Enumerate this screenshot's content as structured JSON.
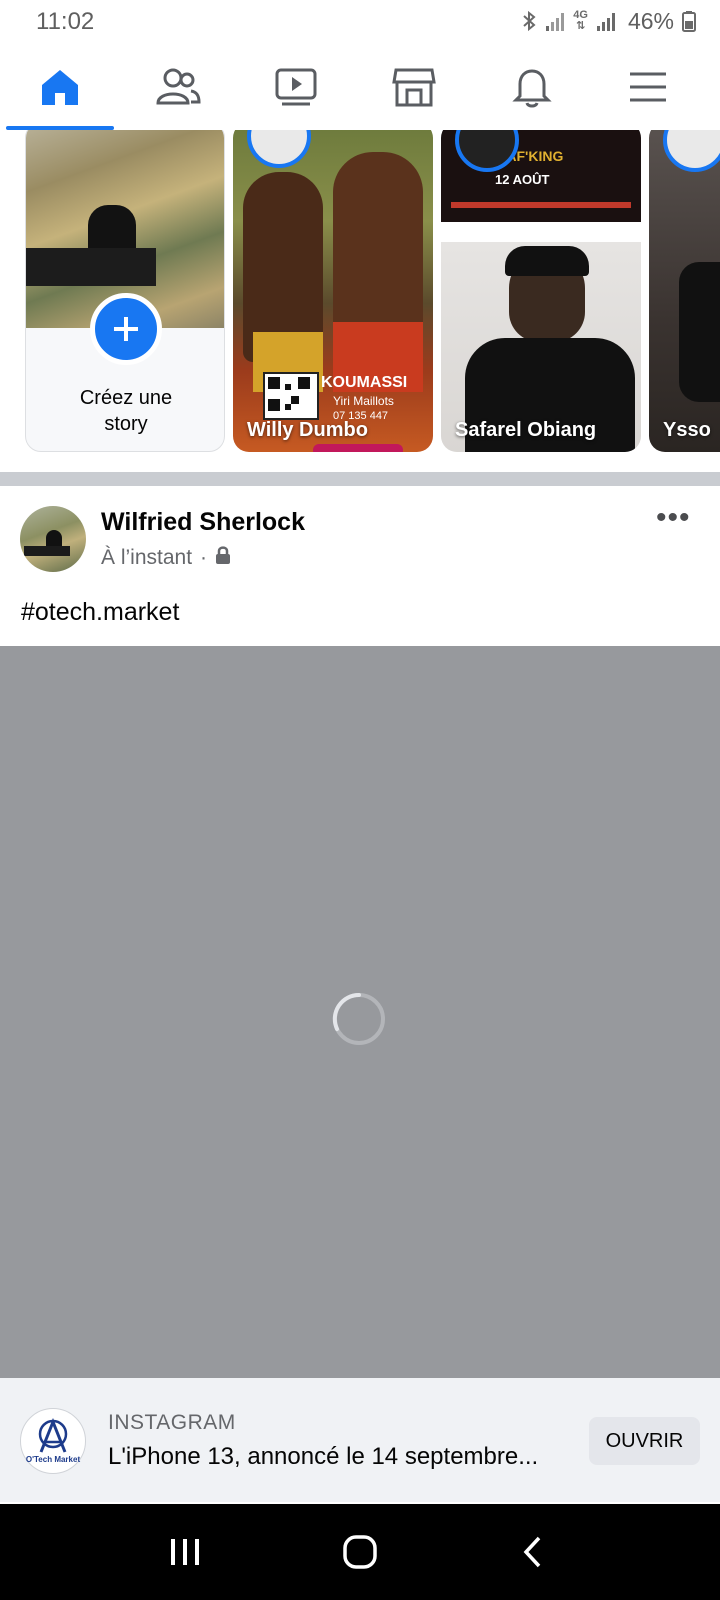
{
  "status_bar": {
    "time": "11:02",
    "network_label": "4G",
    "battery": "46%"
  },
  "top_nav": {
    "items": [
      "home-icon",
      "friends-icon",
      "watch-icon",
      "marketplace-icon",
      "notifications-icon",
      "menu-icon"
    ],
    "active": "home",
    "accent_color": "#1877f2"
  },
  "stories": {
    "create_label": "Créez une story",
    "items": [
      {
        "name": "Willy Dumbo",
        "overlay_title": "KOUMASSI",
        "overlay_sub": "Yiri Maillots",
        "overlay_phone": "07 135 447"
      },
      {
        "name": "Safarel Obiang",
        "poster_title": "SAF'KING",
        "poster_date": "12 AOÛT"
      },
      {
        "name": "Ysso"
      }
    ]
  },
  "post": {
    "author": "Wilfried Sherlock",
    "time": "À l’instant",
    "separator": "·",
    "privacy_icon": "lock-icon",
    "text": "#otech.market"
  },
  "link_preview": {
    "logo_text": "O'Tech Market",
    "source": "INSTAGRAM",
    "title": "L'iPhone 13, annoncé le 14 septembre...",
    "button": "OUVRIR"
  },
  "android_nav": [
    "recents-icon",
    "home-button-icon",
    "back-icon"
  ]
}
